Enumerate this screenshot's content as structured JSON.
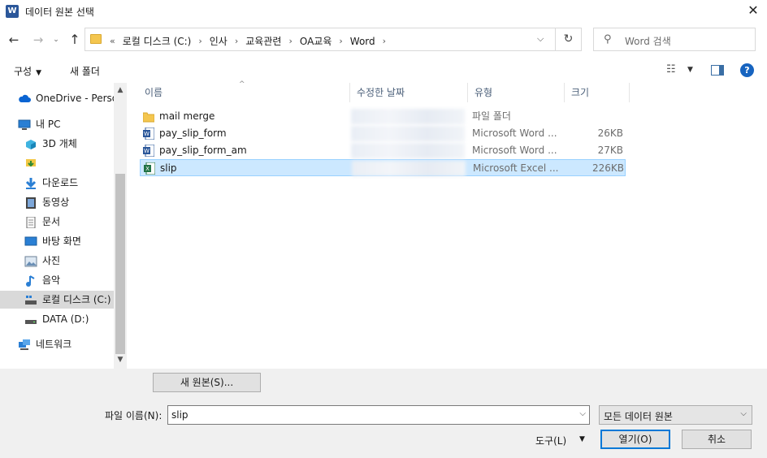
{
  "window": {
    "title": "데이터 원본 선택",
    "app_icon_letter": "W",
    "close_glyph": "✕"
  },
  "address": {
    "overflow": "«",
    "crumbs": [
      "로컬 디스크 (C:)",
      "인사",
      "교육관련",
      "OA교육",
      "Word"
    ],
    "separator": "›",
    "search_placeholder": "Word 검색"
  },
  "toolbar": {
    "organize": "구성",
    "new_folder": "새 폴더"
  },
  "nav": {
    "items": [
      {
        "label": "OneDrive - Personal",
        "icon": "cloud-icon"
      },
      {
        "label": "내 PC",
        "icon": "pc-icon"
      },
      {
        "label": "3D 개체",
        "icon": "cube-icon"
      },
      {
        "label": "",
        "icon": "desktop-download-icon"
      },
      {
        "label": "다운로드",
        "icon": "download-icon"
      },
      {
        "label": "동영상",
        "icon": "video-icon"
      },
      {
        "label": "문서",
        "icon": "document-icon"
      },
      {
        "label": "바탕 화면",
        "icon": "desktop-icon"
      },
      {
        "label": "사진",
        "icon": "picture-icon"
      },
      {
        "label": "음악",
        "icon": "music-icon"
      },
      {
        "label": "로컬 디스크 (C:)",
        "icon": "drive-c-icon"
      },
      {
        "label": "DATA (D:)",
        "icon": "drive-d-icon"
      },
      {
        "label": "네트워크",
        "icon": "network-icon"
      }
    ]
  },
  "columns": {
    "name": "이름",
    "date": "수정한 날짜",
    "type": "유형",
    "size": "크기"
  },
  "files": [
    {
      "name": "mail merge",
      "type": "파일 폴더",
      "size": "",
      "icon": "folder-icon"
    },
    {
      "name": "pay_slip_form",
      "type": "Microsoft Word ...",
      "size": "26KB",
      "icon": "word-file-icon"
    },
    {
      "name": "pay_slip_form_am",
      "type": "Microsoft Word ...",
      "size": "27KB",
      "icon": "word-file-icon"
    },
    {
      "name": "slip",
      "type": "Microsoft Excel ...",
      "size": "226KB",
      "icon": "excel-file-icon"
    }
  ],
  "bottom": {
    "new_source": "새 원본(S)...",
    "filename_label": "파일 이름(N):",
    "filename_value": "slip",
    "filetype_value": "모든 데이터 원본",
    "tools": "도구(L)",
    "open": "열기(O)",
    "cancel": "취소"
  },
  "colors": {
    "selection_bg": "#cce8ff",
    "selection_border": "#99d1ff",
    "accent": "#0078d7"
  }
}
